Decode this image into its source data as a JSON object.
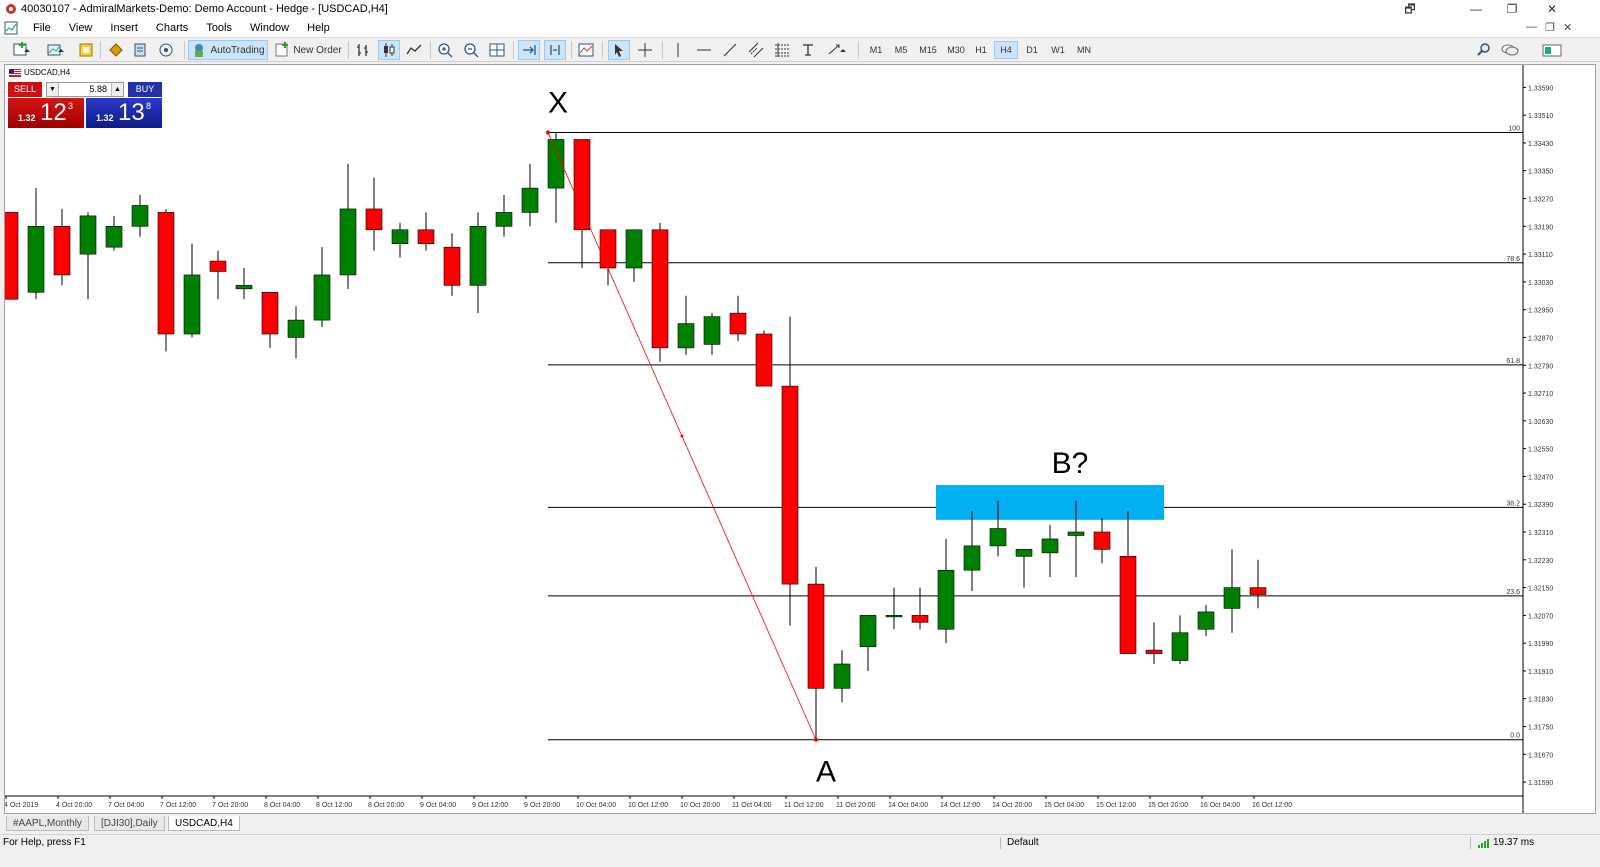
{
  "window": {
    "title": "40030107 - AdmiralMarkets-Demo: Demo Account - Hedge - [USDCAD,H4]",
    "controls": [
      "🗗",
      "—",
      "❐",
      "✕"
    ]
  },
  "menu": {
    "items": [
      "File",
      "View",
      "Insert",
      "Charts",
      "Tools",
      "Window",
      "Help"
    ]
  },
  "toolbar": {
    "autotrading_label": "AutoTrading",
    "new_order_label": "New Order",
    "timeframes": [
      "M1",
      "M5",
      "M15",
      "M30",
      "H1",
      "H4",
      "D1",
      "W1",
      "MN"
    ],
    "active_timeframe": "H4"
  },
  "chart": {
    "symbol_label": "USDCAD,H4",
    "one_click": {
      "sell_label": "SELL",
      "buy_label": "BUY",
      "volume": "5.88",
      "sell_prefix": "1.32",
      "sell_big": "12",
      "sell_sup": "3",
      "buy_prefix": "1.32",
      "buy_big": "13",
      "buy_sup": "8"
    },
    "annotations": {
      "x": "X",
      "a": "A",
      "b": "B?"
    },
    "colors": {
      "bull": "#008000",
      "bear": "#ff0000",
      "zone": "#00b0f0",
      "zigzag": "#ff0000"
    }
  },
  "chart_data": {
    "type": "candlestick",
    "symbol": "USDCAD",
    "timeframe": "H4",
    "ylim": [
      1.3155,
      1.3364
    ],
    "y_ticks": [
      "1.33590",
      "1.33510",
      "1.33430",
      "1.33350",
      "1.33270",
      "1.33190",
      "1.33110",
      "1.33030",
      "1.32950",
      "1.32870",
      "1.32790",
      "1.32710",
      "1.32630",
      "1.32550",
      "1.32470",
      "1.32390",
      "1.32310",
      "1.32230",
      "1.32150",
      "1.32070",
      "1.31990",
      "1.31910",
      "1.31830",
      "1.31750",
      "1.31670",
      "1.31590"
    ],
    "x_ticks": [
      "4 Oct 2019",
      "4 Oct 20:00",
      "7 Oct 04:00",
      "7 Oct 12:00",
      "7 Oct 20:00",
      "8 Oct 04:00",
      "8 Oct 12:00",
      "8 Oct 20:00",
      "9 Oct 04:00",
      "9 Oct 12:00",
      "9 Oct 20:00",
      "10 Oct 04:00",
      "10 Oct 12:00",
      "10 Oct 20:00",
      "11 Oct 04:00",
      "11 Oct 12:00",
      "11 Oct 20:00",
      "14 Oct 04:00",
      "14 Oct 12:00",
      "14 Oct 20:00",
      "15 Oct 04:00",
      "15 Oct 12:00",
      "15 Oct 20:00",
      "16 Oct 04:00",
      "16 Oct 12:00"
    ],
    "candles": [
      {
        "o": 1.3323,
        "h": 1.3323,
        "l": 1.3298,
        "c": 1.3298
      },
      {
        "o": 1.33,
        "h": 1.333,
        "l": 1.3298,
        "c": 1.3319
      },
      {
        "o": 1.3319,
        "h": 1.3324,
        "l": 1.3302,
        "c": 1.3305
      },
      {
        "o": 1.3311,
        "h": 1.3323,
        "l": 1.3298,
        "c": 1.3322
      },
      {
        "o": 1.3313,
        "h": 1.3322,
        "l": 1.3312,
        "c": 1.3319
      },
      {
        "o": 1.3319,
        "h": 1.3328,
        "l": 1.3316,
        "c": 1.3325
      },
      {
        "o": 1.3323,
        "h": 1.3324,
        "l": 1.3283,
        "c": 1.3288
      },
      {
        "o": 1.3288,
        "h": 1.3314,
        "l": 1.3287,
        "c": 1.3305
      },
      {
        "o": 1.3309,
        "h": 1.3312,
        "l": 1.3298,
        "c": 1.3306
      },
      {
        "o": 1.3301,
        "h": 1.3307,
        "l": 1.3298,
        "c": 1.3302
      },
      {
        "o": 1.33,
        "h": 1.33,
        "l": 1.3284,
        "c": 1.3288
      },
      {
        "o": 1.3287,
        "h": 1.3296,
        "l": 1.3281,
        "c": 1.3292
      },
      {
        "o": 1.3292,
        "h": 1.3313,
        "l": 1.329,
        "c": 1.3305
      },
      {
        "o": 1.3305,
        "h": 1.3337,
        "l": 1.3301,
        "c": 1.3324
      },
      {
        "o": 1.3324,
        "h": 1.3333,
        "l": 1.3312,
        "c": 1.3318
      },
      {
        "o": 1.3314,
        "h": 1.332,
        "l": 1.331,
        "c": 1.3318
      },
      {
        "o": 1.3318,
        "h": 1.3323,
        "l": 1.3312,
        "c": 1.3314
      },
      {
        "o": 1.3313,
        "h": 1.3317,
        "l": 1.3299,
        "c": 1.3302
      },
      {
        "o": 1.3302,
        "h": 1.3323,
        "l": 1.3294,
        "c": 1.3319
      },
      {
        "o": 1.3319,
        "h": 1.3328,
        "l": 1.3316,
        "c": 1.3323
      },
      {
        "o": 1.3323,
        "h": 1.3337,
        "l": 1.3319,
        "c": 1.333
      },
      {
        "o": 1.333,
        "h": 1.3346,
        "l": 1.332,
        "c": 1.3344
      },
      {
        "o": 1.3344,
        "h": 1.3344,
        "l": 1.3307,
        "c": 1.3318
      },
      {
        "o": 1.3318,
        "h": 1.3318,
        "l": 1.3302,
        "c": 1.3307
      },
      {
        "o": 1.3307,
        "h": 1.3318,
        "l": 1.3303,
        "c": 1.3318
      },
      {
        "o": 1.3318,
        "h": 1.332,
        "l": 1.328,
        "c": 1.3284
      },
      {
        "o": 1.3284,
        "h": 1.3299,
        "l": 1.3282,
        "c": 1.3291
      },
      {
        "o": 1.3285,
        "h": 1.3294,
        "l": 1.3282,
        "c": 1.3293
      },
      {
        "o": 1.3294,
        "h": 1.3299,
        "l": 1.3286,
        "c": 1.3288
      },
      {
        "o": 1.3288,
        "h": 1.3289,
        "l": 1.3275,
        "c": 1.3273
      },
      {
        "o": 1.3273,
        "h": 1.3293,
        "l": 1.3204,
        "c": 1.3216
      },
      {
        "o": 1.3216,
        "h": 1.3221,
        "l": 1.3171,
        "c": 1.3186
      },
      {
        "o": 1.3186,
        "h": 1.3197,
        "l": 1.3182,
        "c": 1.3193
      },
      {
        "o": 1.3198,
        "h": 1.3207,
        "l": 1.3191,
        "c": 1.3207
      },
      {
        "o": 1.3207,
        "h": 1.3215,
        "l": 1.3203,
        "c": 1.3207
      },
      {
        "o": 1.3207,
        "h": 1.3215,
        "l": 1.3203,
        "c": 1.3205
      },
      {
        "o": 1.3203,
        "h": 1.3229,
        "l": 1.3199,
        "c": 1.322
      },
      {
        "o": 1.322,
        "h": 1.3237,
        "l": 1.3214,
        "c": 1.3227
      },
      {
        "o": 1.3227,
        "h": 1.324,
        "l": 1.3224,
        "c": 1.3232
      },
      {
        "o": 1.3224,
        "h": 1.3226,
        "l": 1.3215,
        "c": 1.3226
      },
      {
        "o": 1.3225,
        "h": 1.3233,
        "l": 1.3218,
        "c": 1.3229
      },
      {
        "o": 1.323,
        "h": 1.324,
        "l": 1.3218,
        "c": 1.3231
      },
      {
        "o": 1.3231,
        "h": 1.3235,
        "l": 1.3222,
        "c": 1.3226
      },
      {
        "o": 1.3224,
        "h": 1.3237,
        "l": 1.3196,
        "c": 1.3196
      },
      {
        "o": 1.3197,
        "h": 1.3205,
        "l": 1.3193,
        "c": 1.3196
      },
      {
        "o": 1.3194,
        "h": 1.3207,
        "l": 1.3193,
        "c": 1.3202
      },
      {
        "o": 1.3203,
        "h": 1.321,
        "l": 1.3201,
        "c": 1.3208
      },
      {
        "o": 1.3209,
        "h": 1.3226,
        "l": 1.3202,
        "c": 1.3215
      },
      {
        "o": 1.3215,
        "h": 1.3223,
        "l": 1.3209,
        "c": 1.3213
      }
    ],
    "fib_levels": [
      {
        "label": "100",
        "price": 1.3346
      },
      {
        "label": "78.6",
        "price": 1.33085
      },
      {
        "label": "61.8",
        "price": 1.32791
      },
      {
        "label": "38.2",
        "price": 1.32381
      },
      {
        "label": "23.6",
        "price": 1.32126
      },
      {
        "label": "0.0",
        "price": 1.31712
      }
    ],
    "zigzag": [
      {
        "candle": 21,
        "price": 1.3346
      },
      {
        "candle": 31,
        "price": 1.31712
      }
    ],
    "b_zone": {
      "from_candle": 36,
      "to_candle": 44,
      "price_top": 1.32445,
      "price_bottom": 1.32345
    }
  },
  "tabs": [
    "#AAPL,Monthly",
    "[DJI30],Daily",
    "USDCAD,H4"
  ],
  "active_tab": "USDCAD,H4",
  "status": {
    "help": "For Help, press F1",
    "profile": "Default",
    "ping": "19.37 ms"
  }
}
